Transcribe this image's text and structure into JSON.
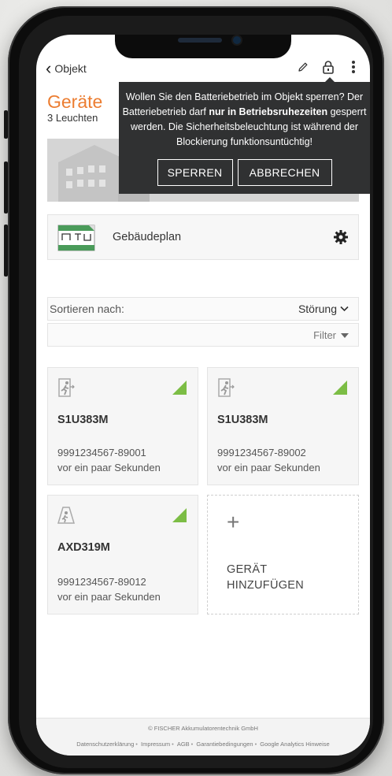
{
  "header": {
    "back_label": "Objekt",
    "icons": [
      "pencil-icon",
      "lock-icon",
      "more-vertical-icon"
    ]
  },
  "page": {
    "title": "Geräte",
    "subtitle": "3 Leuchten"
  },
  "dialog": {
    "message_1": "Wollen Sie den Batteriebetrieb im Objekt sperren? Der Batteriebetrieb darf ",
    "message_bold": "nur in Betriebsruhezeiten",
    "message_2": " gesperrt werden. Die Sicherheitsbeleuchtung ist während der Blockierung funktionsuntüchtig!",
    "confirm_label": "SPERREN",
    "cancel_label": "ABBRECHEN"
  },
  "plan": {
    "label": "Gebäudeplan"
  },
  "sort": {
    "label": "Sortieren nach:",
    "value": "Störung"
  },
  "filter": {
    "label": "Filter"
  },
  "devices": [
    {
      "name": "S1U383M",
      "serial": "9991234567-89001",
      "time": "vor ein paar Sekunden",
      "icon": "emergency-exit-icon",
      "status_color": "#7cbd45"
    },
    {
      "name": "S1U383M",
      "serial": "9991234567-89002",
      "time": "vor ein paar Sekunden",
      "icon": "emergency-exit-icon",
      "status_color": "#7cbd45"
    },
    {
      "name": "AXD319M",
      "serial": "9991234567-89012",
      "time": "vor ein paar Sekunden",
      "icon": "ceiling-light-icon",
      "status_color": "#7cbd45"
    }
  ],
  "add_device": {
    "plus": "+",
    "label_line1": "GERÄT",
    "label_line2": "HINZUFÜGEN"
  },
  "footer": {
    "copyright": "© FISCHER Akkumulatorentechnik GmbH",
    "links": [
      "Datenschutzerklärung",
      "Impressum",
      "AGB",
      "Garantiebedingungen",
      "Google Analytics Hinweise"
    ]
  },
  "colors": {
    "accent": "#ec7d31",
    "status_ok": "#7cbd45",
    "dialog_bg": "#303132"
  }
}
